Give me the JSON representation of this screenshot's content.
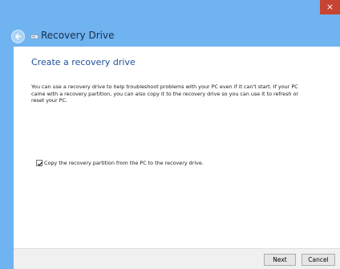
{
  "window": {
    "title": "Recovery Drive",
    "close_glyph": "×"
  },
  "main": {
    "heading": "Create a recovery drive",
    "description": "You can use a recovery drive to help troubleshoot problems with your PC even if it can't start. If your PC came with a recovery partition, you can also copy it to the recovery drive so you can use it to refresh or reset your PC.",
    "checkbox": {
      "label": "Copy the recovery partition from the PC to the recovery drive.",
      "checked": true
    }
  },
  "footer": {
    "next_label": "Next",
    "cancel_label": "Cancel"
  },
  "colors": {
    "accent": "#6fb3f0",
    "close": "#c74433",
    "heading": "#1f4f9a"
  }
}
